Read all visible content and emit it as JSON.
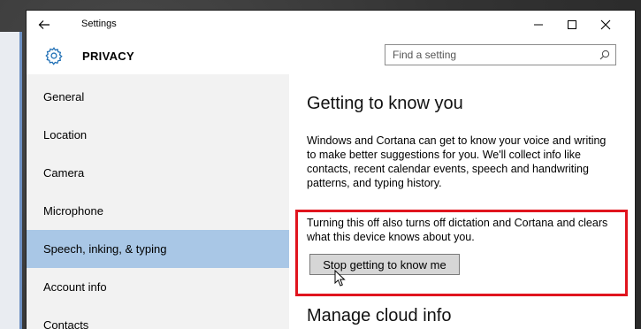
{
  "window": {
    "title": "Settings",
    "section_title": "PRIVACY"
  },
  "search": {
    "placeholder": "Find a setting"
  },
  "sidebar": {
    "items": [
      {
        "label": "General"
      },
      {
        "label": "Location"
      },
      {
        "label": "Camera"
      },
      {
        "label": "Microphone"
      },
      {
        "label": "Speech, inking, & typing",
        "selected": true
      },
      {
        "label": "Account info"
      },
      {
        "label": "Contacts"
      }
    ]
  },
  "main": {
    "heading": "Getting to know you",
    "description": "Windows and Cortana can get to know your voice and writing to make better suggestions for you. We'll collect info like contacts, recent calendar events, speech and handwriting patterns, and typing history.",
    "warning": "Turning this off also turns off dictation and Cortana and clears what this device knows about you.",
    "button_label": "Stop getting to know me",
    "next_heading": "Manage cloud info"
  },
  "colors": {
    "selected_nav": "#a9c7e6",
    "highlight_border": "#e0141e",
    "gear_accent": "#1f6fb5"
  },
  "icons": [
    "back-arrow-icon",
    "minimize-icon",
    "maximize-icon",
    "close-icon",
    "gear-icon",
    "search-icon",
    "mouse-cursor-icon"
  ]
}
